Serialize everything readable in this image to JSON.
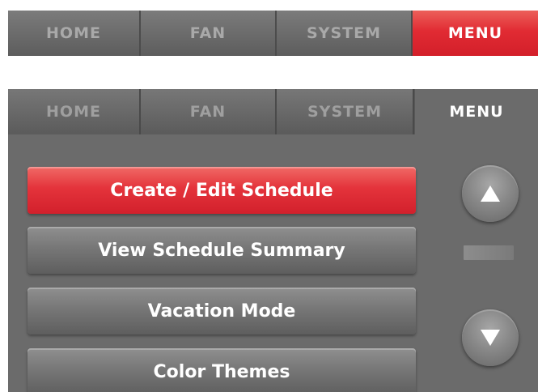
{
  "top_tabs": [
    {
      "label": "HOME"
    },
    {
      "label": "FAN"
    },
    {
      "label": "SYSTEM"
    },
    {
      "label": "MENU"
    }
  ],
  "panel_tabs": [
    {
      "label": "HOME"
    },
    {
      "label": "FAN"
    },
    {
      "label": "SYSTEM"
    },
    {
      "label": "MENU"
    }
  ],
  "menu": {
    "items": [
      {
        "label": "Create / Edit Schedule"
      },
      {
        "label": "View Schedule Summary"
      },
      {
        "label": "Vacation Mode"
      },
      {
        "label": "Color Themes"
      }
    ]
  },
  "controls": {
    "up_icon": "triangle-up-icon",
    "down_icon": "triangle-down-icon"
  },
  "colors": {
    "accent_red": "#e12b33",
    "panel_gray": "#6b6b6b"
  }
}
